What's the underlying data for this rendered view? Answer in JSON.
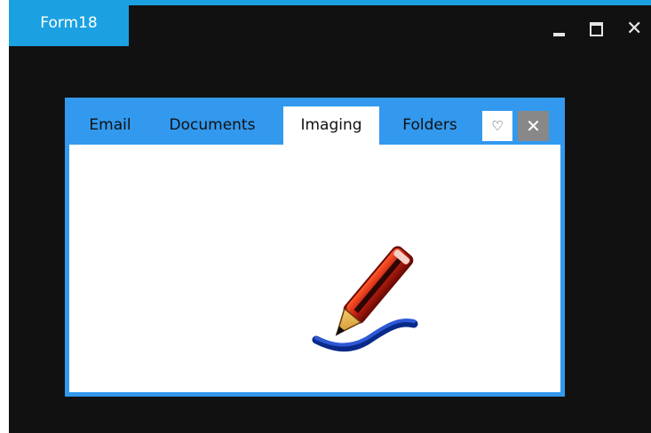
{
  "window": {
    "title": "Form18",
    "accent_color": "#1ba1e2",
    "background_color": "#111111",
    "controls": {
      "minimize_icon": "minimize-icon",
      "maximize_icon": "maximize-icon",
      "close_icon": "close-icon",
      "close_glyph": "✕"
    }
  },
  "tabcontrol": {
    "accent_color": "#3399ee",
    "tabs": [
      {
        "label": "Email"
      },
      {
        "label": "Documents"
      },
      {
        "label": "Imaging",
        "selected": true
      },
      {
        "label": "Folders"
      }
    ],
    "favorite_glyph": "♡",
    "close_glyph": "✕",
    "content_icon": "pencil-icon"
  }
}
